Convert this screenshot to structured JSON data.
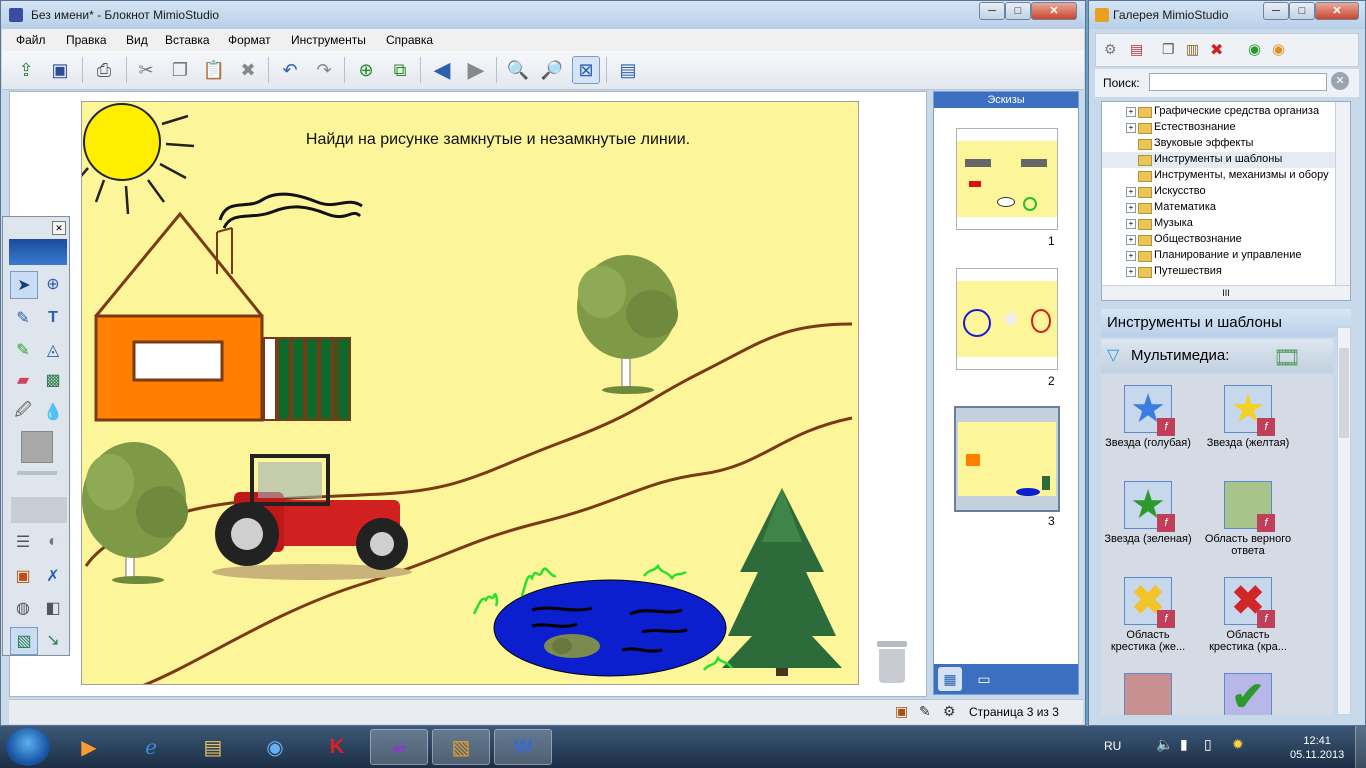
{
  "main_window": {
    "title": "Без имени* - Блокнот MimioStudio",
    "controls": {
      "minimize": "─",
      "maximize": "□",
      "close": "✕"
    },
    "menu": [
      "Файл",
      "Правка",
      "Вид",
      "Вставка",
      "Формат",
      "Инструменты",
      "Справка"
    ],
    "toolbar_icons": [
      "open-icon",
      "save-icon",
      "print-icon",
      "cut-icon",
      "copy-icon",
      "paste-icon",
      "delete-icon",
      "undo-icon",
      "redo-icon",
      "new-page-icon",
      "duplicate-page-icon",
      "prev-page-icon",
      "next-page-icon",
      "zoom-in-icon",
      "zoom-out-icon",
      "fit-page-icon",
      "screen-icon"
    ]
  },
  "page": {
    "instruction": "Найди на рисунке замкнутые и незамкнутые линии."
  },
  "thumbnails": {
    "header": "Эскизы",
    "pages": [
      "1",
      "2",
      "3"
    ]
  },
  "status": {
    "page_indicator": "Страница 3 из 3"
  },
  "gallery": {
    "title": "Галерея MimioStudio",
    "search_label": "Поиск:",
    "search_value": "",
    "tree": [
      {
        "label": "Графические средства организа",
        "expandable": true
      },
      {
        "label": "Естествознание",
        "expandable": true
      },
      {
        "label": "Звуковые эффекты",
        "expandable": false
      },
      {
        "label": "Инструменты и шаблоны",
        "expandable": false
      },
      {
        "label": "Инструменты, механизмы и обору",
        "expandable": false
      },
      {
        "label": "Искусство",
        "expandable": true
      },
      {
        "label": "Математика",
        "expandable": true
      },
      {
        "label": "Музыка",
        "expandable": true
      },
      {
        "label": "Обществознание",
        "expandable": true
      },
      {
        "label": "Планирование и управление",
        "expandable": true
      },
      {
        "label": "Путешествия",
        "expandable": true
      }
    ],
    "tree_hscroll_label": "III",
    "category_title": "Инструменты и шаблоны",
    "subcategory": "Мультимедиа:",
    "items": [
      {
        "label": "Звезда (голубая)",
        "color": "#3a7ce0"
      },
      {
        "label": "Звезда (желтая)",
        "color": "#f2d12a"
      },
      {
        "label": "Звезда (зеленая)",
        "color": "#2e9a2e"
      },
      {
        "label": "Область верного ответа",
        "color": "#a8c48a"
      },
      {
        "label": "Область крестика (же...",
        "color": "#f2c42a"
      },
      {
        "label": "Область крестика (кра...",
        "color": "#d02828"
      }
    ],
    "badge_letter": "f"
  },
  "taskbar": {
    "language": "RU",
    "time": "12:41",
    "date": "05.11.2013"
  },
  "colors": {
    "page_bg": "#fdf59a",
    "pond": "#0b1fcf",
    "house_wall": "#ff7f00",
    "road": "#7a3a14"
  }
}
